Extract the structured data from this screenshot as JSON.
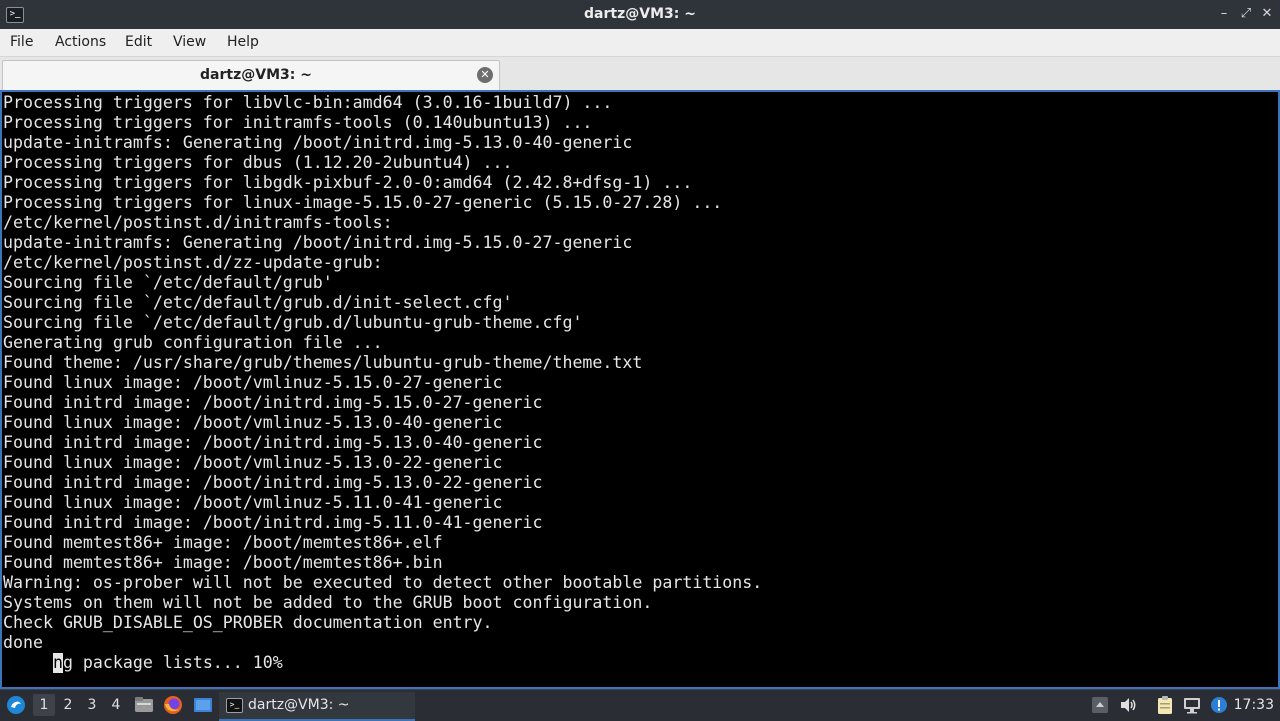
{
  "window": {
    "title": "dartz@VM3: ~",
    "app_icon": "terminal-icon",
    "controls": {
      "minimize": "–",
      "restore": "⤢",
      "close": "✕"
    }
  },
  "menu": {
    "items": [
      {
        "label": "File"
      },
      {
        "label": "Actions"
      },
      {
        "label": "Edit"
      },
      {
        "label": "View"
      },
      {
        "label": "Help"
      }
    ]
  },
  "tabs": [
    {
      "label": "dartz@VM3: ~",
      "close_icon": "close-circle-icon"
    }
  ],
  "terminal": {
    "lines": [
      "Processing triggers for libvlc-bin:amd64 (3.0.16-1build7) ...",
      "Processing triggers for initramfs-tools (0.140ubuntu13) ...",
      "update-initramfs: Generating /boot/initrd.img-5.13.0-40-generic",
      "Processing triggers for dbus (1.12.20-2ubuntu4) ...",
      "Processing triggers for libgdk-pixbuf-2.0-0:amd64 (2.42.8+dfsg-1) ...",
      "Processing triggers for linux-image-5.15.0-27-generic (5.15.0-27.28) ...",
      "/etc/kernel/postinst.d/initramfs-tools:",
      "update-initramfs: Generating /boot/initrd.img-5.15.0-27-generic",
      "/etc/kernel/postinst.d/zz-update-grub:",
      "Sourcing file `/etc/default/grub'",
      "Sourcing file `/etc/default/grub.d/init-select.cfg'",
      "Sourcing file `/etc/default/grub.d/lubuntu-grub-theme.cfg'",
      "Generating grub configuration file ...",
      "Found theme: /usr/share/grub/themes/lubuntu-grub-theme/theme.txt",
      "Found linux image: /boot/vmlinuz-5.15.0-27-generic",
      "Found initrd image: /boot/initrd.img-5.15.0-27-generic",
      "Found linux image: /boot/vmlinuz-5.13.0-40-generic",
      "Found initrd image: /boot/initrd.img-5.13.0-40-generic",
      "Found linux image: /boot/vmlinuz-5.13.0-22-generic",
      "Found initrd image: /boot/initrd.img-5.13.0-22-generic",
      "Found linux image: /boot/vmlinuz-5.11.0-41-generic",
      "Found initrd image: /boot/initrd.img-5.11.0-41-generic",
      "Found memtest86+ image: /boot/memtest86+.elf",
      "Found memtest86+ image: /boot/memtest86+.bin",
      "Warning: os-prober will not be executed to detect other bootable partitions.",
      "Systems on them will not be added to the GRUB boot configuration.",
      "Check GRUB_DISABLE_OS_PROBER documentation entry.",
      "done"
    ],
    "progress_prefix": "     ",
    "progress_cursor_char": "n",
    "progress_rest": "g package lists... 10%"
  },
  "taskbar": {
    "start_icon": "lubuntu-logo-icon",
    "desktops": [
      "1",
      "2",
      "3",
      "4"
    ],
    "active_desktop": "1",
    "quicklaunch": [
      "file-manager-icon",
      "firefox-icon",
      "show-desktop-icon"
    ],
    "task": {
      "label": "dartz@VM3: ~",
      "icon": "terminal-icon"
    },
    "tray": [
      "tray-arrow-icon",
      "volume-icon",
      "clipboard-icon",
      "network-icon",
      "update-notifier-icon"
    ],
    "clock": "17:33"
  },
  "colors": {
    "accent": "#3b74b8",
    "terminal_bg": "#000000",
    "terminal_fg": "#e6e6e6",
    "titlebar_bg": "#2f343a",
    "taskbar_bg": "#2a2d33"
  }
}
